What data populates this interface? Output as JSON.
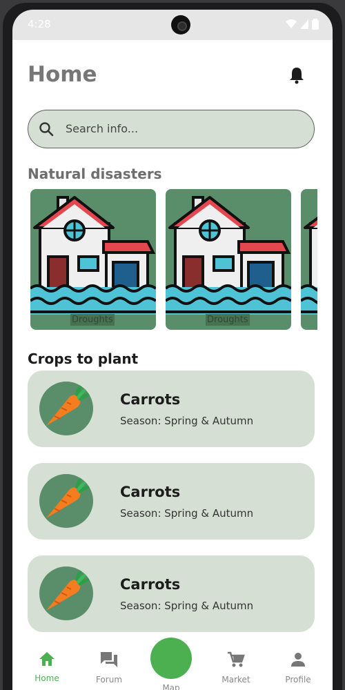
{
  "status_bar": {
    "time": "4:28"
  },
  "header": {
    "title": "Home"
  },
  "search": {
    "placeholder": "Search info..."
  },
  "natural_disasters": {
    "title": "Natural disasters",
    "items": [
      {
        "label": "Droughts"
      },
      {
        "label": "Droughts"
      }
    ]
  },
  "crops": {
    "title": "Crops to plant",
    "items": [
      {
        "name": "Carrots",
        "season": "Season: Spring & Autumn"
      },
      {
        "name": "Carrots",
        "season": "Season: Spring & Autumn"
      },
      {
        "name": "Carrots",
        "season": "Season: Spring & Autumn"
      }
    ]
  },
  "bottom_nav": {
    "items": [
      {
        "label": "Home",
        "icon": "home-icon"
      },
      {
        "label": "Forum",
        "icon": "forum-icon"
      },
      {
        "label": "Map",
        "icon": "map-icon"
      },
      {
        "label": "Market",
        "icon": "cart-icon"
      },
      {
        "label": "Profile",
        "icon": "person-icon"
      }
    ]
  },
  "colors": {
    "accent": "#4caf50",
    "card_bg": "#d5dfd3",
    "tile_green": "#5a8e6a"
  }
}
